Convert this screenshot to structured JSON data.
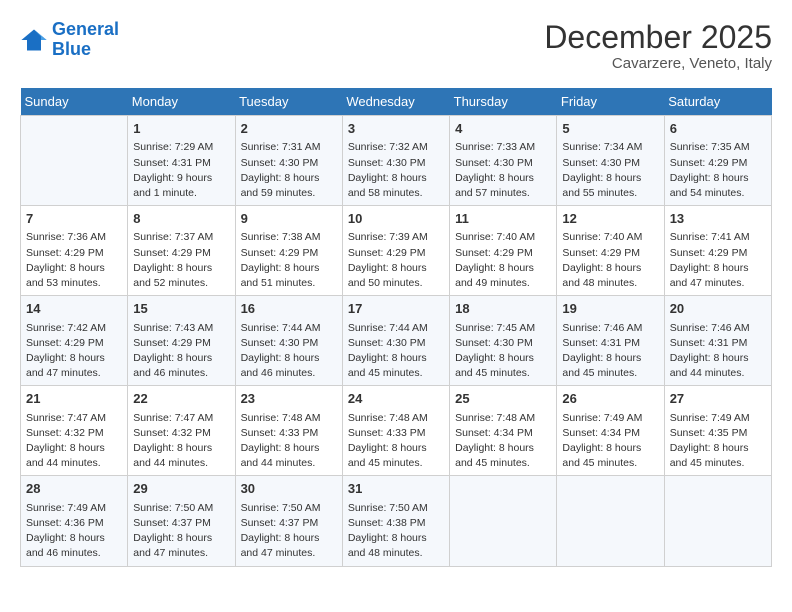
{
  "header": {
    "logo_line1": "General",
    "logo_line2": "Blue",
    "month": "December 2025",
    "location": "Cavarzere, Veneto, Italy"
  },
  "days_of_week": [
    "Sunday",
    "Monday",
    "Tuesday",
    "Wednesday",
    "Thursday",
    "Friday",
    "Saturday"
  ],
  "weeks": [
    [
      {
        "day": "",
        "info": ""
      },
      {
        "day": "1",
        "info": "Sunrise: 7:29 AM\nSunset: 4:31 PM\nDaylight: 9 hours\nand 1 minute."
      },
      {
        "day": "2",
        "info": "Sunrise: 7:31 AM\nSunset: 4:30 PM\nDaylight: 8 hours\nand 59 minutes."
      },
      {
        "day": "3",
        "info": "Sunrise: 7:32 AM\nSunset: 4:30 PM\nDaylight: 8 hours\nand 58 minutes."
      },
      {
        "day": "4",
        "info": "Sunrise: 7:33 AM\nSunset: 4:30 PM\nDaylight: 8 hours\nand 57 minutes."
      },
      {
        "day": "5",
        "info": "Sunrise: 7:34 AM\nSunset: 4:30 PM\nDaylight: 8 hours\nand 55 minutes."
      },
      {
        "day": "6",
        "info": "Sunrise: 7:35 AM\nSunset: 4:29 PM\nDaylight: 8 hours\nand 54 minutes."
      }
    ],
    [
      {
        "day": "7",
        "info": "Sunrise: 7:36 AM\nSunset: 4:29 PM\nDaylight: 8 hours\nand 53 minutes."
      },
      {
        "day": "8",
        "info": "Sunrise: 7:37 AM\nSunset: 4:29 PM\nDaylight: 8 hours\nand 52 minutes."
      },
      {
        "day": "9",
        "info": "Sunrise: 7:38 AM\nSunset: 4:29 PM\nDaylight: 8 hours\nand 51 minutes."
      },
      {
        "day": "10",
        "info": "Sunrise: 7:39 AM\nSunset: 4:29 PM\nDaylight: 8 hours\nand 50 minutes."
      },
      {
        "day": "11",
        "info": "Sunrise: 7:40 AM\nSunset: 4:29 PM\nDaylight: 8 hours\nand 49 minutes."
      },
      {
        "day": "12",
        "info": "Sunrise: 7:40 AM\nSunset: 4:29 PM\nDaylight: 8 hours\nand 48 minutes."
      },
      {
        "day": "13",
        "info": "Sunrise: 7:41 AM\nSunset: 4:29 PM\nDaylight: 8 hours\nand 47 minutes."
      }
    ],
    [
      {
        "day": "14",
        "info": "Sunrise: 7:42 AM\nSunset: 4:29 PM\nDaylight: 8 hours\nand 47 minutes."
      },
      {
        "day": "15",
        "info": "Sunrise: 7:43 AM\nSunset: 4:29 PM\nDaylight: 8 hours\nand 46 minutes."
      },
      {
        "day": "16",
        "info": "Sunrise: 7:44 AM\nSunset: 4:30 PM\nDaylight: 8 hours\nand 46 minutes."
      },
      {
        "day": "17",
        "info": "Sunrise: 7:44 AM\nSunset: 4:30 PM\nDaylight: 8 hours\nand 45 minutes."
      },
      {
        "day": "18",
        "info": "Sunrise: 7:45 AM\nSunset: 4:30 PM\nDaylight: 8 hours\nand 45 minutes."
      },
      {
        "day": "19",
        "info": "Sunrise: 7:46 AM\nSunset: 4:31 PM\nDaylight: 8 hours\nand 45 minutes."
      },
      {
        "day": "20",
        "info": "Sunrise: 7:46 AM\nSunset: 4:31 PM\nDaylight: 8 hours\nand 44 minutes."
      }
    ],
    [
      {
        "day": "21",
        "info": "Sunrise: 7:47 AM\nSunset: 4:32 PM\nDaylight: 8 hours\nand 44 minutes."
      },
      {
        "day": "22",
        "info": "Sunrise: 7:47 AM\nSunset: 4:32 PM\nDaylight: 8 hours\nand 44 minutes."
      },
      {
        "day": "23",
        "info": "Sunrise: 7:48 AM\nSunset: 4:33 PM\nDaylight: 8 hours\nand 44 minutes."
      },
      {
        "day": "24",
        "info": "Sunrise: 7:48 AM\nSunset: 4:33 PM\nDaylight: 8 hours\nand 45 minutes."
      },
      {
        "day": "25",
        "info": "Sunrise: 7:48 AM\nSunset: 4:34 PM\nDaylight: 8 hours\nand 45 minutes."
      },
      {
        "day": "26",
        "info": "Sunrise: 7:49 AM\nSunset: 4:34 PM\nDaylight: 8 hours\nand 45 minutes."
      },
      {
        "day": "27",
        "info": "Sunrise: 7:49 AM\nSunset: 4:35 PM\nDaylight: 8 hours\nand 45 minutes."
      }
    ],
    [
      {
        "day": "28",
        "info": "Sunrise: 7:49 AM\nSunset: 4:36 PM\nDaylight: 8 hours\nand 46 minutes."
      },
      {
        "day": "29",
        "info": "Sunrise: 7:50 AM\nSunset: 4:37 PM\nDaylight: 8 hours\nand 47 minutes."
      },
      {
        "day": "30",
        "info": "Sunrise: 7:50 AM\nSunset: 4:37 PM\nDaylight: 8 hours\nand 47 minutes."
      },
      {
        "day": "31",
        "info": "Sunrise: 7:50 AM\nSunset: 4:38 PM\nDaylight: 8 hours\nand 48 minutes."
      },
      {
        "day": "",
        "info": ""
      },
      {
        "day": "",
        "info": ""
      },
      {
        "day": "",
        "info": ""
      }
    ]
  ]
}
